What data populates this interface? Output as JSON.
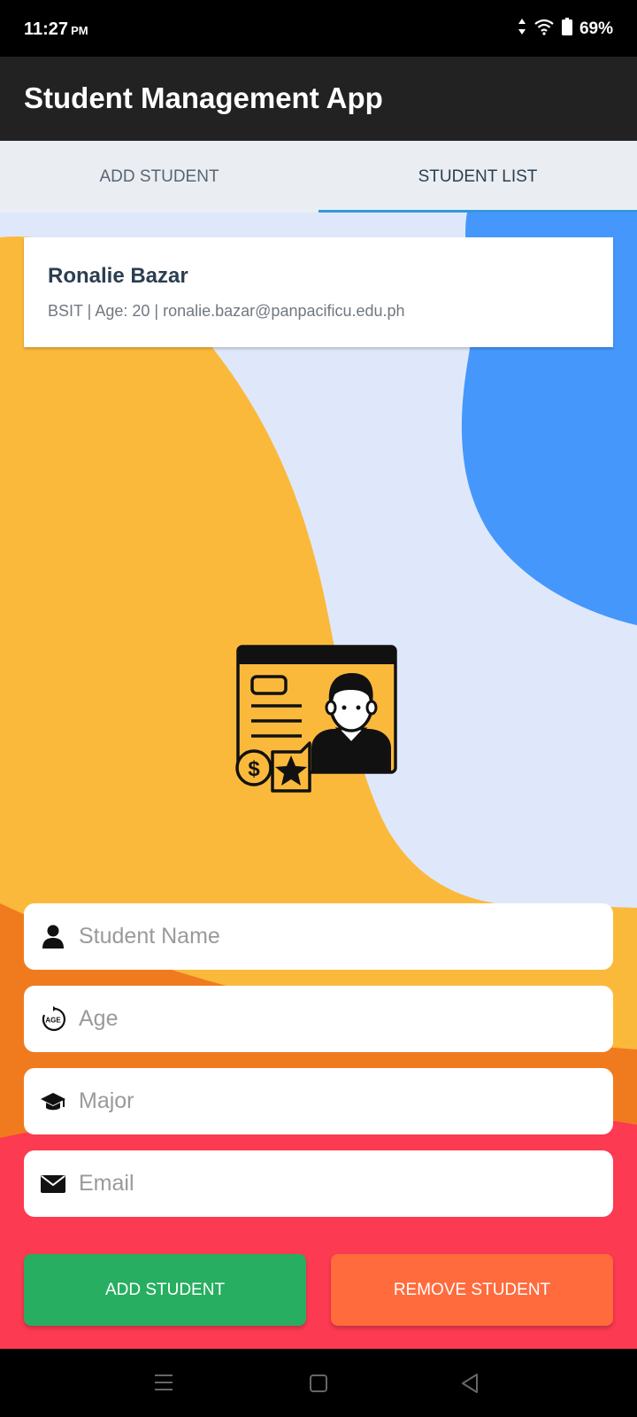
{
  "status_bar": {
    "time": "11:27",
    "ampm": "PM",
    "battery": "69%"
  },
  "app_bar": {
    "title": "Student Management App"
  },
  "tabs": [
    {
      "label": "ADD STUDENT",
      "active": false
    },
    {
      "label": "STUDENT LIST",
      "active": true
    }
  ],
  "student_card": {
    "name": "Ronalie Bazar",
    "details": "BSIT | Age: 20 | ronalie.bazar@panpacificu.edu.ph"
  },
  "form": {
    "name_placeholder": "Student Name",
    "age_placeholder": "Age",
    "major_placeholder": "Major",
    "email_placeholder": "Email",
    "age_icon_text": "AGE"
  },
  "buttons": {
    "add_label": "ADD STUDENT",
    "remove_label": "REMOVE STUDENT"
  },
  "icons": {
    "status": [
      "data-arrows-icon",
      "wifi-icon",
      "battery-icon"
    ],
    "fields": [
      "person-icon",
      "age-icon",
      "graduation-cap-icon",
      "envelope-icon"
    ],
    "nav": [
      "menu-icon",
      "home-square-icon",
      "back-triangle-icon"
    ],
    "illustration": "student-profile-illustration"
  },
  "colors": {
    "app_bar": "#222222",
    "tab_indicator": "#3498db",
    "add_button": "#27ae60",
    "remove_button": "#ff6b3d",
    "bg_yellow": "#fbb93c",
    "bg_orange": "#f07b1f",
    "bg_red": "#fc3a51",
    "bg_blue": "#4597fc",
    "bg_light": "#dfe8fa"
  }
}
